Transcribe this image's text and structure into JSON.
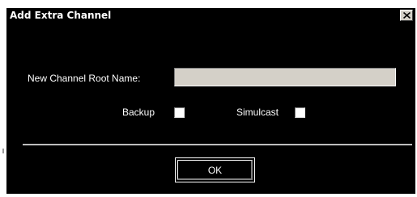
{
  "dialog": {
    "title": "Add Extra Channel",
    "close_icon": "close-icon",
    "fields": {
      "root_name_label": "New Channel Root Name:",
      "root_name_value": ""
    },
    "options": {
      "backup_label": "Backup",
      "backup_checked": false,
      "simulcast_label": "Simulcast",
      "simulcast_checked": false
    },
    "ok_label": "OK"
  },
  "colors": {
    "dialog_background": "#000000",
    "text": "#ffffff",
    "field_background": "#d4d0c8",
    "checkbox_background": "#ffffff"
  }
}
